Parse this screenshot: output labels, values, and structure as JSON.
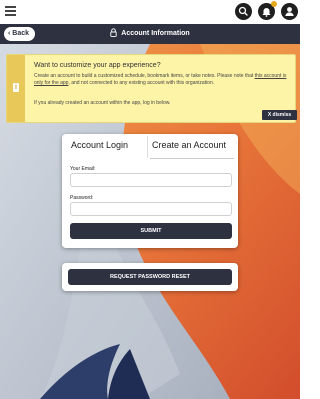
{
  "topbar": {
    "menu_icon": "hamburger-icon",
    "search_icon": "search-icon",
    "notifications_icon": "bell-icon",
    "account_icon": "user-icon"
  },
  "nav": {
    "back_label": "Back",
    "title": "Account Information",
    "title_icon": "lock-icon"
  },
  "notice": {
    "title": "Want to customize your app experience?",
    "body_part1": "Create an account to build a customized schedule, bookmark items, or take notes. Please note that ",
    "body_link": "this account is only for the app",
    "body_part2": ", and not connected to any existing account with this organization.",
    "body_login": "If you already created an account within the app, log in below.",
    "dismiss_label": "X dismiss",
    "info_icon": "info-icon",
    "colors": {
      "background": "#fdf4a8",
      "side": "#e9c85a"
    }
  },
  "login": {
    "tabs": [
      "Account Login",
      "Create an Account"
    ],
    "email_label": "Your Email:",
    "email_value": "",
    "password_label": "Password:",
    "password_value": "",
    "submit_label": "SUBMIT"
  },
  "reset": {
    "label": "REQUEST PASSWORD RESET"
  },
  "colors": {
    "primary": "#2d3140",
    "wallpaper_orange": "#e8763a",
    "wallpaper_grey": "#b8bfcb"
  }
}
